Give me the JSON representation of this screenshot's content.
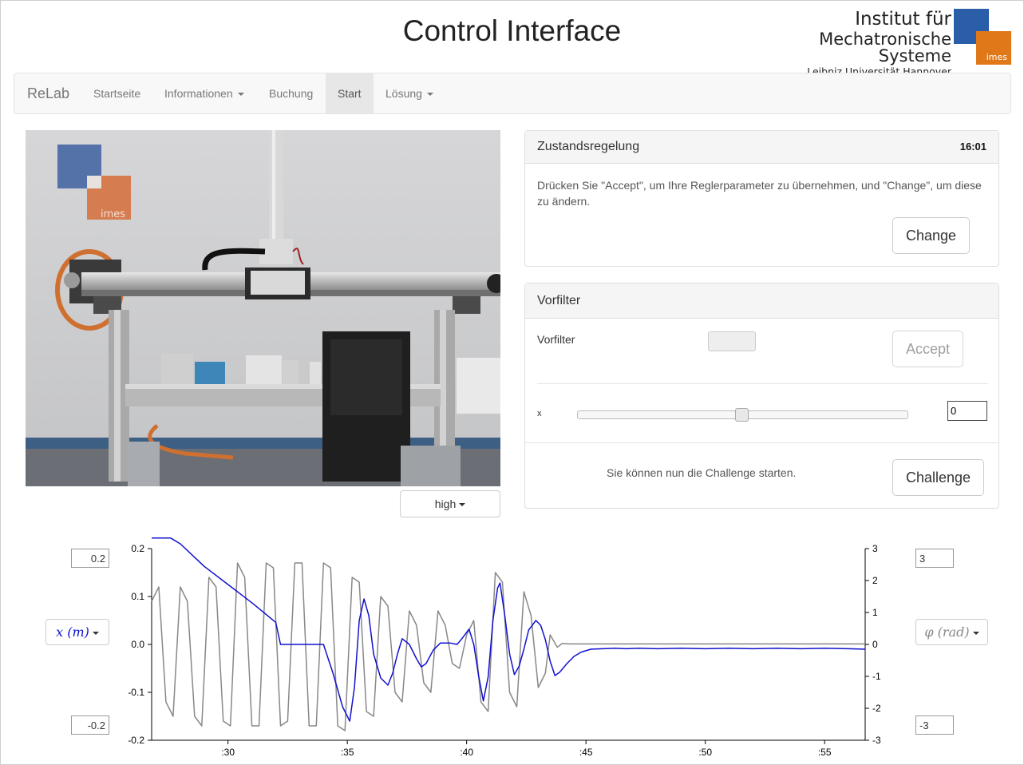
{
  "header": {
    "title": "Control Interface",
    "logo": {
      "line1": "Institut für",
      "line2": "Mechatronische Systeme",
      "line3": "Leibniz Universität Hannover",
      "tag": "imes",
      "colors": {
        "blue": "#2a5ea8",
        "orange": "#e0781a"
      }
    }
  },
  "navbar": {
    "brand": "ReLab",
    "items": [
      {
        "label": "Startseite",
        "dropdown": false,
        "active": false
      },
      {
        "label": "Informationen",
        "dropdown": true,
        "active": false
      },
      {
        "label": "Buchung",
        "dropdown": false,
        "active": false
      },
      {
        "label": "Start",
        "dropdown": false,
        "active": true
      },
      {
        "label": "Lösung",
        "dropdown": true,
        "active": false
      }
    ]
  },
  "camera": {
    "quality": "high",
    "sign": "imes"
  },
  "zustandsregelung": {
    "title": "Zustandsregelung",
    "timer": "16:01",
    "text": "Drücken Sie \"Accept\", um Ihre Reglerparameter zu übernehmen, und \"Change\", um diese zu ändern.",
    "change_label": "Change"
  },
  "vorfilter": {
    "title": "Vorfilter",
    "field_label": "Vorfilter",
    "field_value": "",
    "accept_label": "Accept",
    "slider_label": "x",
    "slider_value": 0.5,
    "slider_input": "0",
    "challenge_text": "Sie können nun die Challenge starten.",
    "challenge_label": "Challenge"
  },
  "plot": {
    "left_max": "0.2",
    "left_min": "-0.2",
    "right_max": "3",
    "right_min": "-3",
    "left_select": "x (m)",
    "right_select": "φ (rad)"
  },
  "chart_data": {
    "type": "line",
    "x_ticks": [
      ":30",
      ":35",
      ":40",
      ":45",
      ":50",
      ":55"
    ],
    "y_left_ticks": [
      "0.2",
      "0.1",
      "0.0",
      "-0.1",
      "-0.2"
    ],
    "y_right_ticks": [
      "3",
      "2",
      "1",
      "0",
      "-1",
      "-2",
      "-3"
    ],
    "ylim_left": [
      -0.2,
      0.2
    ],
    "ylim_right": [
      -3,
      3
    ],
    "xlim": [
      26.8,
      56.7
    ],
    "series": [
      {
        "color": "#1010d0",
        "axis": "left",
        "points": [
          [
            26.8,
            0.222
          ],
          [
            27.6,
            0.222
          ],
          [
            28,
            0.21
          ],
          [
            29,
            0.163
          ],
          [
            30,
            0.125
          ],
          [
            31,
            0.087
          ],
          [
            32,
            0.046
          ],
          [
            32.2,
            0.0
          ],
          [
            33.2,
            0.0
          ],
          [
            34,
            0.0
          ],
          [
            34.4,
            -0.06
          ],
          [
            34.8,
            -0.13
          ],
          [
            35.1,
            -0.16
          ],
          [
            35.3,
            -0.09
          ],
          [
            35.5,
            0.05
          ],
          [
            35.7,
            0.095
          ],
          [
            35.9,
            0.06
          ],
          [
            36.1,
            -0.02
          ],
          [
            36.4,
            -0.07
          ],
          [
            36.7,
            -0.085
          ],
          [
            36.9,
            -0.06
          ],
          [
            37.1,
            -0.02
          ],
          [
            37.3,
            0.012
          ],
          [
            37.6,
            0.0
          ],
          [
            37.9,
            -0.03
          ],
          [
            38.1,
            -0.047
          ],
          [
            38.3,
            -0.04
          ],
          [
            38.6,
            -0.012
          ],
          [
            38.9,
            0.003
          ],
          [
            39.3,
            0.003
          ],
          [
            39.6,
            0.0
          ],
          [
            39.8,
            0.012
          ],
          [
            40.1,
            0.032
          ],
          [
            40.3,
            0.0
          ],
          [
            40.5,
            -0.065
          ],
          [
            40.7,
            -0.118
          ],
          [
            40.9,
            -0.068
          ],
          [
            41.1,
            0.05
          ],
          [
            41.3,
            0.118
          ],
          [
            41.4,
            0.128
          ],
          [
            41.6,
            0.06
          ],
          [
            41.8,
            -0.02
          ],
          [
            42.0,
            -0.063
          ],
          [
            42.2,
            -0.045
          ],
          [
            42.4,
            -0.01
          ],
          [
            42.6,
            0.03
          ],
          [
            42.9,
            0.05
          ],
          [
            43.1,
            0.04
          ],
          [
            43.3,
            0.01
          ],
          [
            43.5,
            -0.035
          ],
          [
            43.7,
            -0.065
          ],
          [
            43.9,
            -0.058
          ],
          [
            44.2,
            -0.04
          ],
          [
            44.5,
            -0.025
          ],
          [
            44.8,
            -0.016
          ],
          [
            45.2,
            -0.01
          ],
          [
            45.7,
            -0.009
          ],
          [
            46.2,
            -0.008
          ],
          [
            46.7,
            -0.009
          ],
          [
            47.2,
            -0.008
          ],
          [
            48,
            -0.009
          ],
          [
            49,
            -0.008
          ],
          [
            50,
            -0.009
          ],
          [
            51,
            -0.008
          ],
          [
            52,
            -0.009
          ],
          [
            53,
            -0.008
          ],
          [
            54,
            -0.009
          ],
          [
            55,
            -0.008
          ],
          [
            56,
            -0.009
          ],
          [
            56.7,
            -0.01
          ]
        ]
      },
      {
        "color": "#888888",
        "axis": "left",
        "points": [
          [
            26.8,
            0.09
          ],
          [
            27.1,
            0.12
          ],
          [
            27.4,
            -0.12
          ],
          [
            27.7,
            -0.15
          ],
          [
            28,
            0.12
          ],
          [
            28.3,
            0.09
          ],
          [
            28.6,
            -0.15
          ],
          [
            28.9,
            -0.17
          ],
          [
            29.2,
            0.14
          ],
          [
            29.5,
            0.12
          ],
          [
            29.8,
            -0.16
          ],
          [
            30.1,
            -0.17
          ],
          [
            30.4,
            0.17
          ],
          [
            30.7,
            0.14
          ],
          [
            31.0,
            -0.17
          ],
          [
            31.3,
            -0.17
          ],
          [
            31.6,
            0.17
          ],
          [
            31.9,
            0.16
          ],
          [
            32.2,
            -0.17
          ],
          [
            32.5,
            -0.16
          ],
          [
            32.8,
            0.17
          ],
          [
            33.1,
            0.17
          ],
          [
            33.4,
            -0.17
          ],
          [
            33.7,
            -0.17
          ],
          [
            34.0,
            0.17
          ],
          [
            34.3,
            0.16
          ],
          [
            34.6,
            -0.17
          ],
          [
            34.9,
            -0.18
          ],
          [
            35.2,
            0.14
          ],
          [
            35.5,
            0.13
          ],
          [
            35.8,
            -0.14
          ],
          [
            36.1,
            -0.15
          ],
          [
            36.4,
            0.1
          ],
          [
            36.7,
            0.08
          ],
          [
            37.0,
            -0.1
          ],
          [
            37.3,
            -0.12
          ],
          [
            37.6,
            0.07
          ],
          [
            37.9,
            0.04
          ],
          [
            38.2,
            -0.08
          ],
          [
            38.5,
            -0.1
          ],
          [
            38.8,
            0.07
          ],
          [
            39.1,
            0.04
          ],
          [
            39.4,
            -0.04
          ],
          [
            39.7,
            -0.05
          ],
          [
            40.0,
            0.02
          ],
          [
            40.3,
            0.05
          ],
          [
            40.6,
            -0.12
          ],
          [
            40.9,
            -0.14
          ],
          [
            41.2,
            0.15
          ],
          [
            41.5,
            0.13
          ],
          [
            41.8,
            -0.1
          ],
          [
            42.1,
            -0.13
          ],
          [
            42.4,
            0.11
          ],
          [
            42.7,
            0.06
          ],
          [
            43.0,
            -0.09
          ],
          [
            43.3,
            -0.06
          ],
          [
            43.5,
            0.02
          ],
          [
            43.8,
            -0.006
          ],
          [
            44.0,
            0.002
          ],
          [
            44.3,
            0.001
          ],
          [
            45,
            0.001
          ],
          [
            46,
            0.001
          ],
          [
            48,
            0.001
          ],
          [
            50,
            0.001
          ],
          [
            52,
            0.001
          ],
          [
            54,
            0.001
          ],
          [
            56.7,
            0.001
          ]
        ]
      }
    ]
  }
}
